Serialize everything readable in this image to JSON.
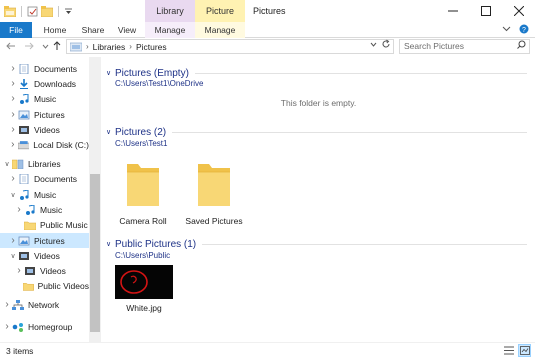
{
  "window": {
    "title": "Pictures",
    "context_tabs": [
      "Library Tools",
      "Picture Tools"
    ],
    "controls": [
      "minimize",
      "maximize",
      "close"
    ]
  },
  "ribbon": {
    "tabs": [
      "File",
      "Home",
      "Share",
      "View",
      "Manage",
      "Manage"
    ],
    "active_tab": "File"
  },
  "address": {
    "crumbs": [
      "Libraries",
      "Pictures"
    ],
    "search_placeholder": "Search Pictures"
  },
  "nav": {
    "items": [
      {
        "label": "Documents",
        "icon": "documents-icon",
        "indent": 1,
        "expander": "collapsed"
      },
      {
        "label": "Downloads",
        "icon": "downloads-icon",
        "indent": 1,
        "expander": "collapsed"
      },
      {
        "label": "Music",
        "icon": "music-icon",
        "indent": 1,
        "expander": "collapsed"
      },
      {
        "label": "Pictures",
        "icon": "pictures-icon",
        "indent": 1,
        "expander": "collapsed"
      },
      {
        "label": "Videos",
        "icon": "videos-icon",
        "indent": 1,
        "expander": "collapsed"
      },
      {
        "label": "Local Disk (C:)",
        "icon": "drive-icon",
        "indent": 1,
        "expander": "collapsed"
      },
      {
        "label": "Libraries",
        "icon": "libraries-icon",
        "indent": 0,
        "expander": "expanded"
      },
      {
        "label": "Documents",
        "icon": "documents-icon",
        "indent": 1,
        "expander": "collapsed"
      },
      {
        "label": "Music",
        "icon": "music-icon",
        "indent": 1,
        "expander": "expanded"
      },
      {
        "label": "Music",
        "icon": "music-icon",
        "indent": 2,
        "expander": "collapsed"
      },
      {
        "label": "Public Music",
        "icon": "folder-icon",
        "indent": 2,
        "expander": "none"
      },
      {
        "label": "Pictures",
        "icon": "pictures-icon",
        "indent": 1,
        "expander": "collapsed",
        "selected": true
      },
      {
        "label": "Videos",
        "icon": "videos-icon",
        "indent": 1,
        "expander": "expanded"
      },
      {
        "label": "Videos",
        "icon": "videos-icon",
        "indent": 2,
        "expander": "collapsed"
      },
      {
        "label": "Public Videos",
        "icon": "folder-icon",
        "indent": 2,
        "expander": "none"
      },
      {
        "label": "Network",
        "icon": "network-icon",
        "indent": 0,
        "expander": "collapsed"
      },
      {
        "label": "Homegroup",
        "icon": "homegroup-icon",
        "indent": 0,
        "expander": "collapsed"
      }
    ]
  },
  "content": {
    "groups": [
      {
        "title": "Pictures (Empty)",
        "path": "C:\\Users\\Test1\\OneDrive",
        "empty_message": "This folder is empty."
      },
      {
        "title": "Pictures (2)",
        "path": "C:\\Users\\Test1",
        "items": [
          "Camera Roll",
          "Saved Pictures"
        ]
      },
      {
        "title": "Public Pictures (1)",
        "path": "C:\\Users\\Public",
        "items": [
          "White.jpg"
        ]
      }
    ]
  },
  "status": {
    "item_count": "3 items"
  },
  "colors": {
    "accent": "#1979ca",
    "group_header": "#1e3287",
    "selection": "#cce8ff",
    "folder": "#f8d775"
  }
}
